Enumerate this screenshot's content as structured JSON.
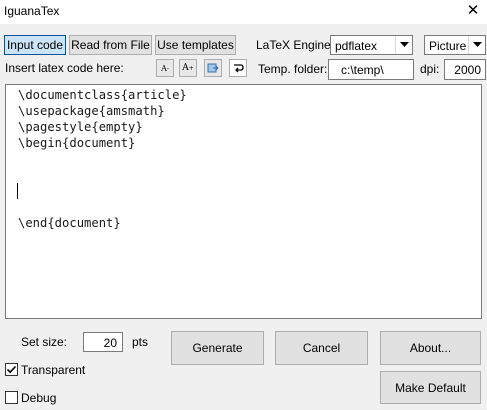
{
  "window": {
    "title": "IguanaTex",
    "close_glyph": "✕"
  },
  "tabs": {
    "input_code": "Input code",
    "read_from_file": "Read from File",
    "use_templates": "Use templates"
  },
  "engine": {
    "label": "LaTeX Engine:",
    "value": "pdflatex"
  },
  "output_type": {
    "value": "Picture"
  },
  "insert_label": "Insert latex code here:",
  "font_buttons": {
    "decrease": "A",
    "increase": "A"
  },
  "temp_folder": {
    "label": "Temp. folder:",
    "value": "c:\\temp\\"
  },
  "dpi": {
    "label": "dpi:",
    "value": "2000"
  },
  "editor": {
    "lines": [
      "\\documentclass{article}",
      "\\usepackage{amsmath}",
      "\\pagestyle{empty}",
      "\\begin{document}",
      "",
      "",
      "",
      "",
      "\\end{document}"
    ]
  },
  "set_size": {
    "label": "Set size:",
    "value": "20",
    "unit": "pts"
  },
  "buttons": {
    "generate": "Generate",
    "cancel": "Cancel",
    "about": "About...",
    "make_default": "Make Default"
  },
  "options": {
    "transparent": {
      "label": "Transparent",
      "checked": true
    },
    "debug": {
      "label": "Debug",
      "checked": false
    }
  }
}
